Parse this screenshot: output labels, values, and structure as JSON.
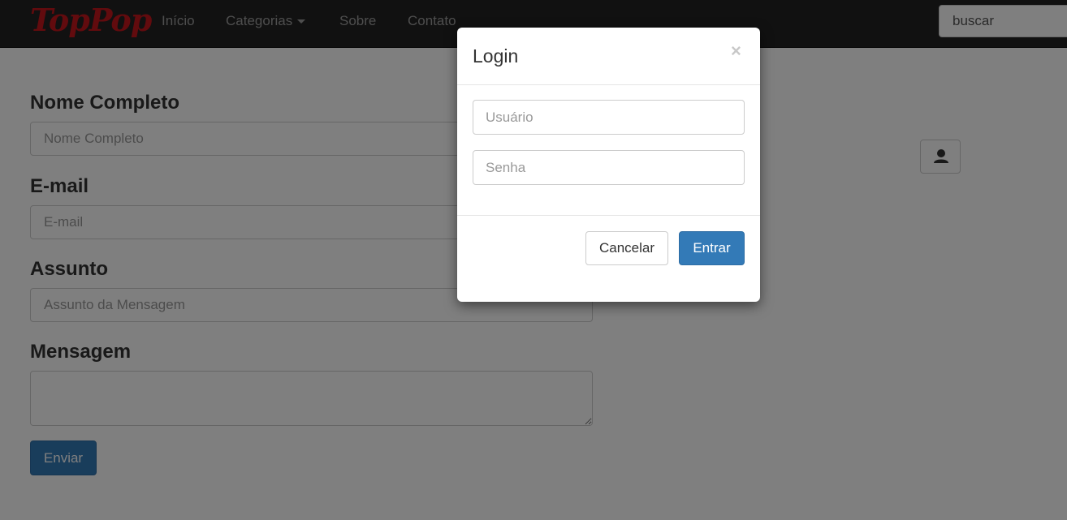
{
  "navbar": {
    "brand": "TopPop",
    "links": [
      "Início",
      "Categorias",
      "Sobre",
      "Contato"
    ],
    "search_placeholder": "buscar"
  },
  "form": {
    "name_label": "Nome Completo",
    "name_placeholder": "Nome Completo",
    "email_label": "E-mail",
    "email_placeholder": "E-mail",
    "subject_label": "Assunto",
    "subject_placeholder": "Assunto da Mensagem",
    "message_label": "Mensagem",
    "submit_label": "Enviar"
  },
  "modal": {
    "title": "Login",
    "close_symbol": "×",
    "username_placeholder": "Usuário",
    "password_placeholder": "Senha",
    "cancel_label": "Cancelar",
    "submit_label": "Entrar"
  },
  "colors": {
    "navbar_bg": "#222222",
    "brand": "#c4161c",
    "primary": "#337ab7",
    "backdrop": "rgba(0,0,0,0.5)"
  },
  "icons": [
    "caret-down-icon",
    "user-icon"
  ]
}
